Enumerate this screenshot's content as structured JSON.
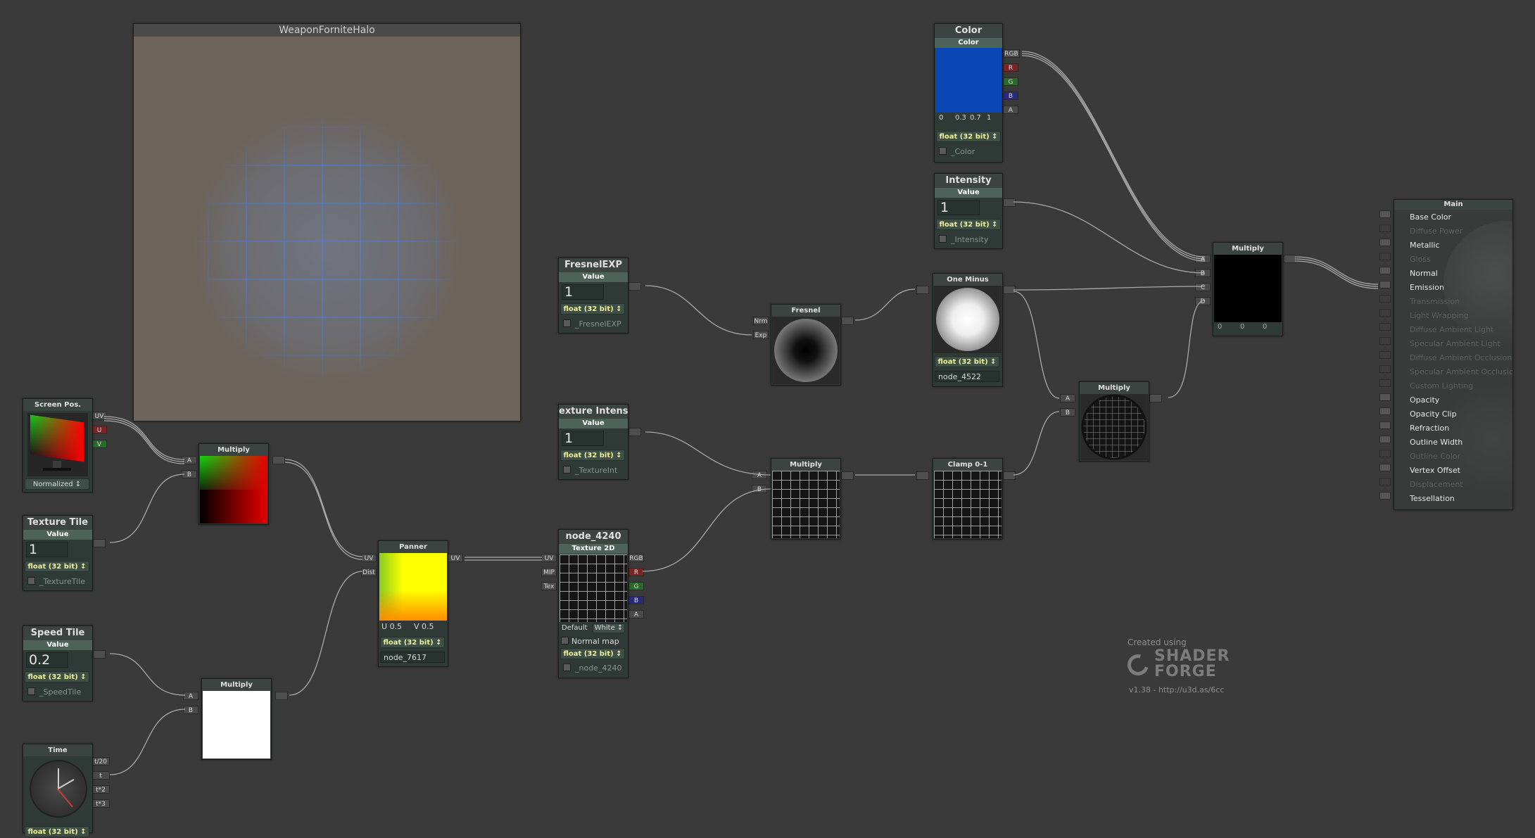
{
  "preview": {
    "title": "WeaponForniteHalo"
  },
  "screen_pos": {
    "title": "Screen Pos.",
    "ports": [
      "UV",
      "U",
      "V"
    ],
    "mode": "Normalized"
  },
  "texture_tile": {
    "title": "Texture Tile",
    "sub": "Value",
    "value": "1",
    "precision": "float (32 bit)",
    "prop_name": "_TextureTile"
  },
  "speed_tile": {
    "title": "Speed Tile",
    "sub": "Value",
    "value": "0.2",
    "precision": "float (32 bit)",
    "prop_name": "_SpeedTile"
  },
  "time": {
    "title": "Time",
    "ports": [
      "t/20",
      "t",
      "t*2",
      "t*3"
    ],
    "precision": "float (32 bit)"
  },
  "multiply_uv": {
    "title": "Multiply",
    "ports": [
      "A",
      "B"
    ]
  },
  "multiply_speed": {
    "title": "Multiply",
    "ports": [
      "A",
      "B"
    ]
  },
  "panner": {
    "title": "Panner",
    "in_ports": [
      "UV",
      "Dist"
    ],
    "out_port": "UV",
    "u_label": "U",
    "u_value": "0.5",
    "v_label": "V",
    "v_value": "0.5",
    "precision": "float (32 bit)",
    "name": "node_7617"
  },
  "fresnel_exp": {
    "title": "FresnelEXP",
    "sub": "Value",
    "value": "1",
    "precision": "float (32 bit)",
    "prop_name": "_FresnelEXP"
  },
  "texture_intensity": {
    "title": "exture Intensi",
    "sub": "Value",
    "value": "1",
    "precision": "float (32 bit)",
    "prop_name": "_TextureInt"
  },
  "texture2d": {
    "title": "node_4240",
    "sub": "Texture 2D",
    "in_ports": [
      "UV",
      "MIP",
      "Tex"
    ],
    "out_ports": [
      "RGB",
      "R",
      "G",
      "B",
      "A"
    ],
    "default_label": "Default",
    "default_value": "White",
    "normal_map": "Normal map",
    "precision": "float (32 bit)",
    "prop_name": "_node_4240"
  },
  "fresnel": {
    "title": "Fresnel",
    "ports": [
      "Nrm",
      "Exp"
    ]
  },
  "multiply_tex": {
    "title": "Multiply",
    "ports": [
      "A",
      "B"
    ]
  },
  "one_minus": {
    "title": "One Minus",
    "precision": "float (32 bit)",
    "name": "node_4522"
  },
  "clamp": {
    "title": "Clamp 0-1"
  },
  "color": {
    "title": "Color",
    "sub": "Color",
    "hex": "#0a47b5",
    "ports": [
      "RGB",
      "R",
      "G",
      "B",
      "A"
    ],
    "values": [
      "0",
      "0.3",
      "0.7",
      "1"
    ],
    "precision": "float (32 bit)",
    "prop_name": "_Color"
  },
  "intensity": {
    "title": "Intensity",
    "sub": "Value",
    "value": "1",
    "precision": "float (32 bit)",
    "prop_name": "_Intensity"
  },
  "multiply_main": {
    "title": "Multiply",
    "ports": [
      "A",
      "B",
      "C",
      "D"
    ],
    "values": [
      "0",
      "0",
      "0"
    ]
  },
  "multiply_grid": {
    "title": "Multiply",
    "ports": [
      "A",
      "B"
    ]
  },
  "main": {
    "title": "Main",
    "inputs": [
      {
        "label": "Base Color",
        "active": true
      },
      {
        "label": "Diffuse Power",
        "active": false
      },
      {
        "label": "Metallic",
        "active": true
      },
      {
        "label": "Gloss",
        "active": false
      },
      {
        "label": "Normal",
        "active": true
      },
      {
        "label": "Emission",
        "active": true
      },
      {
        "label": "Transmission",
        "active": false
      },
      {
        "label": "Light Wrapping",
        "active": false
      },
      {
        "label": "Diffuse Ambient Light",
        "active": false
      },
      {
        "label": "Specular Ambient Light",
        "active": false
      },
      {
        "label": "Diffuse Ambient Occlusion",
        "active": false
      },
      {
        "label": "Specular Ambient Occlusion",
        "active": false
      },
      {
        "label": "Custom Lighting",
        "active": false
      },
      {
        "label": "Opacity",
        "active": true
      },
      {
        "label": "Opacity Clip",
        "active": true
      },
      {
        "label": "Refraction",
        "active": true
      },
      {
        "label": "Outline Width",
        "active": true
      },
      {
        "label": "Outline Color",
        "active": false
      },
      {
        "label": "Vertex Offset",
        "active": true
      },
      {
        "label": "Displacement",
        "active": false
      },
      {
        "label": "Tessellation",
        "active": true
      }
    ]
  },
  "branding": {
    "created": "Created using",
    "line1": "SHADER",
    "line2": "FORGE",
    "version": "v1.38 - http://u3d.as/6cc"
  }
}
